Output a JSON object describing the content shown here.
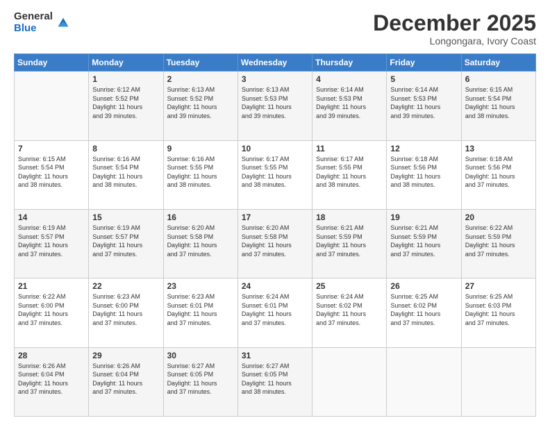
{
  "logo": {
    "general": "General",
    "blue": "Blue"
  },
  "title": {
    "month": "December 2025",
    "location": "Longongara, Ivory Coast"
  },
  "days_of_week": [
    "Sunday",
    "Monday",
    "Tuesday",
    "Wednesday",
    "Thursday",
    "Friday",
    "Saturday"
  ],
  "weeks": [
    [
      {
        "day": "",
        "info": ""
      },
      {
        "day": "1",
        "info": "Sunrise: 6:12 AM\nSunset: 5:52 PM\nDaylight: 11 hours\nand 39 minutes."
      },
      {
        "day": "2",
        "info": "Sunrise: 6:13 AM\nSunset: 5:52 PM\nDaylight: 11 hours\nand 39 minutes."
      },
      {
        "day": "3",
        "info": "Sunrise: 6:13 AM\nSunset: 5:53 PM\nDaylight: 11 hours\nand 39 minutes."
      },
      {
        "day": "4",
        "info": "Sunrise: 6:14 AM\nSunset: 5:53 PM\nDaylight: 11 hours\nand 39 minutes."
      },
      {
        "day": "5",
        "info": "Sunrise: 6:14 AM\nSunset: 5:53 PM\nDaylight: 11 hours\nand 39 minutes."
      },
      {
        "day": "6",
        "info": "Sunrise: 6:15 AM\nSunset: 5:54 PM\nDaylight: 11 hours\nand 38 minutes."
      }
    ],
    [
      {
        "day": "7",
        "info": "Sunrise: 6:15 AM\nSunset: 5:54 PM\nDaylight: 11 hours\nand 38 minutes."
      },
      {
        "day": "8",
        "info": "Sunrise: 6:16 AM\nSunset: 5:54 PM\nDaylight: 11 hours\nand 38 minutes."
      },
      {
        "day": "9",
        "info": "Sunrise: 6:16 AM\nSunset: 5:55 PM\nDaylight: 11 hours\nand 38 minutes."
      },
      {
        "day": "10",
        "info": "Sunrise: 6:17 AM\nSunset: 5:55 PM\nDaylight: 11 hours\nand 38 minutes."
      },
      {
        "day": "11",
        "info": "Sunrise: 6:17 AM\nSunset: 5:55 PM\nDaylight: 11 hours\nand 38 minutes."
      },
      {
        "day": "12",
        "info": "Sunrise: 6:18 AM\nSunset: 5:56 PM\nDaylight: 11 hours\nand 38 minutes."
      },
      {
        "day": "13",
        "info": "Sunrise: 6:18 AM\nSunset: 5:56 PM\nDaylight: 11 hours\nand 37 minutes."
      }
    ],
    [
      {
        "day": "14",
        "info": "Sunrise: 6:19 AM\nSunset: 5:57 PM\nDaylight: 11 hours\nand 37 minutes."
      },
      {
        "day": "15",
        "info": "Sunrise: 6:19 AM\nSunset: 5:57 PM\nDaylight: 11 hours\nand 37 minutes."
      },
      {
        "day": "16",
        "info": "Sunrise: 6:20 AM\nSunset: 5:58 PM\nDaylight: 11 hours\nand 37 minutes."
      },
      {
        "day": "17",
        "info": "Sunrise: 6:20 AM\nSunset: 5:58 PM\nDaylight: 11 hours\nand 37 minutes."
      },
      {
        "day": "18",
        "info": "Sunrise: 6:21 AM\nSunset: 5:59 PM\nDaylight: 11 hours\nand 37 minutes."
      },
      {
        "day": "19",
        "info": "Sunrise: 6:21 AM\nSunset: 5:59 PM\nDaylight: 11 hours\nand 37 minutes."
      },
      {
        "day": "20",
        "info": "Sunrise: 6:22 AM\nSunset: 5:59 PM\nDaylight: 11 hours\nand 37 minutes."
      }
    ],
    [
      {
        "day": "21",
        "info": "Sunrise: 6:22 AM\nSunset: 6:00 PM\nDaylight: 11 hours\nand 37 minutes."
      },
      {
        "day": "22",
        "info": "Sunrise: 6:23 AM\nSunset: 6:00 PM\nDaylight: 11 hours\nand 37 minutes."
      },
      {
        "day": "23",
        "info": "Sunrise: 6:23 AM\nSunset: 6:01 PM\nDaylight: 11 hours\nand 37 minutes."
      },
      {
        "day": "24",
        "info": "Sunrise: 6:24 AM\nSunset: 6:01 PM\nDaylight: 11 hours\nand 37 minutes."
      },
      {
        "day": "25",
        "info": "Sunrise: 6:24 AM\nSunset: 6:02 PM\nDaylight: 11 hours\nand 37 minutes."
      },
      {
        "day": "26",
        "info": "Sunrise: 6:25 AM\nSunset: 6:02 PM\nDaylight: 11 hours\nand 37 minutes."
      },
      {
        "day": "27",
        "info": "Sunrise: 6:25 AM\nSunset: 6:03 PM\nDaylight: 11 hours\nand 37 minutes."
      }
    ],
    [
      {
        "day": "28",
        "info": "Sunrise: 6:26 AM\nSunset: 6:04 PM\nDaylight: 11 hours\nand 37 minutes."
      },
      {
        "day": "29",
        "info": "Sunrise: 6:26 AM\nSunset: 6:04 PM\nDaylight: 11 hours\nand 37 minutes."
      },
      {
        "day": "30",
        "info": "Sunrise: 6:27 AM\nSunset: 6:05 PM\nDaylight: 11 hours\nand 37 minutes."
      },
      {
        "day": "31",
        "info": "Sunrise: 6:27 AM\nSunset: 6:05 PM\nDaylight: 11 hours\nand 38 minutes."
      },
      {
        "day": "",
        "info": ""
      },
      {
        "day": "",
        "info": ""
      },
      {
        "day": "",
        "info": ""
      }
    ]
  ]
}
